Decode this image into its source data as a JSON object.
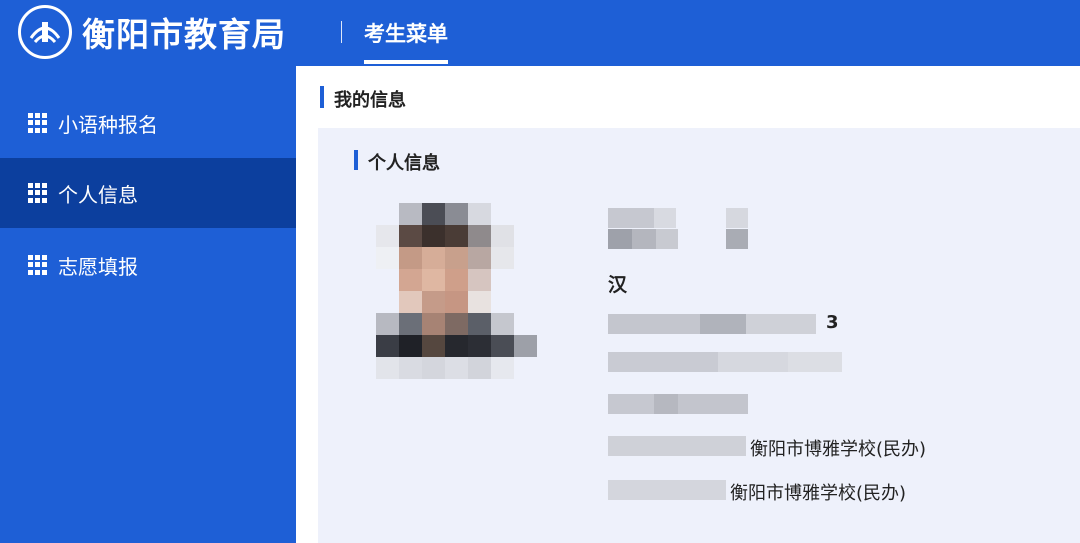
{
  "header": {
    "org_name": "衡阳市教育局",
    "menu_title": "考生菜单",
    "logo_icon": "education-bureau-logo-icon"
  },
  "sidebar": {
    "items": [
      {
        "label": "小语种报名",
        "icon": "grid-icon",
        "active": false
      },
      {
        "label": "个人信息",
        "icon": "grid-icon",
        "active": true
      },
      {
        "label": "志愿填报",
        "icon": "grid-icon",
        "active": false
      }
    ]
  },
  "main": {
    "section_title": "我的信息",
    "card_title": "个人信息",
    "fields": {
      "ethnicity": "汉",
      "id_suffix": "3",
      "school": "衡阳市博雅学校(民办)",
      "school_2": "衡阳市博雅学校(民办)"
    }
  },
  "colors": {
    "primary": "#1e5fd6",
    "active": "#0c3f9e",
    "card_bg": "#eef1fb"
  }
}
